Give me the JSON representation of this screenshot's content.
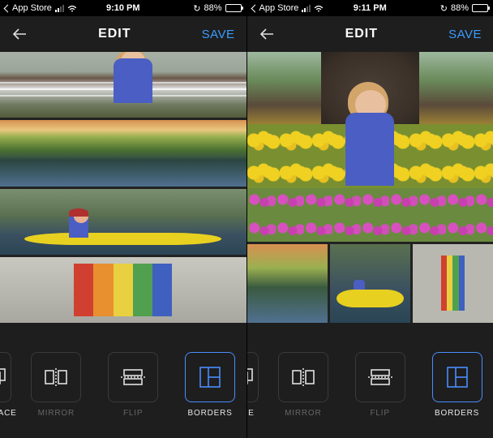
{
  "left": {
    "status": {
      "back_app": "App Store",
      "time": "9:10 PM",
      "battery_pct": "88%"
    },
    "nav": {
      "title": "EDIT",
      "save": "SAVE"
    },
    "tools": {
      "replace": "REPLACE",
      "mirror": "MIRROR",
      "flip": "FLIP",
      "borders": "BORDERS"
    }
  },
  "right": {
    "status": {
      "back_app": "App Store",
      "time": "9:11 PM",
      "battery_pct": "88%"
    },
    "nav": {
      "title": "EDIT",
      "save": "SAVE"
    },
    "tools": {
      "replace_cut": "LACE",
      "mirror": "MIRROR",
      "flip": "FLIP",
      "borders": "BORDERS"
    }
  }
}
